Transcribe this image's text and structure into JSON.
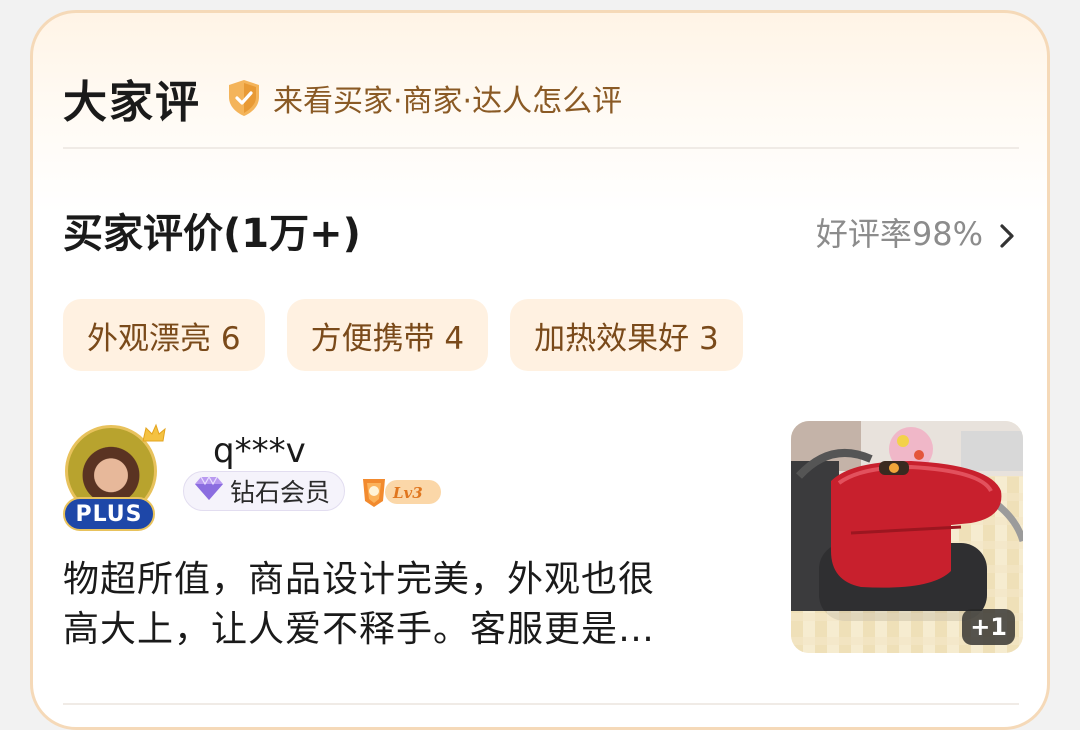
{
  "header": {
    "title": "大家评",
    "subtitle": "来看买家·商家·达人怎么评",
    "shield_icon": "shield-check-icon",
    "accent_color": "#f0a848"
  },
  "buyer_reviews": {
    "title": "买家评价(1万+)",
    "good_rate_label": "好评率98%",
    "tags": [
      {
        "label": "外观漂亮 6"
      },
      {
        "label": "方便携带 4"
      },
      {
        "label": "加热效果好 3"
      }
    ]
  },
  "review": {
    "username": "q***v",
    "plus_badge": "PLUS",
    "member_level": "钻石会员",
    "user_level": "Lv3",
    "text_lines": [
      "物超所值，商品设计完美，外观也很",
      "高大上，让人爱不释手。客服更是…"
    ],
    "image_count_badge": "+1"
  }
}
